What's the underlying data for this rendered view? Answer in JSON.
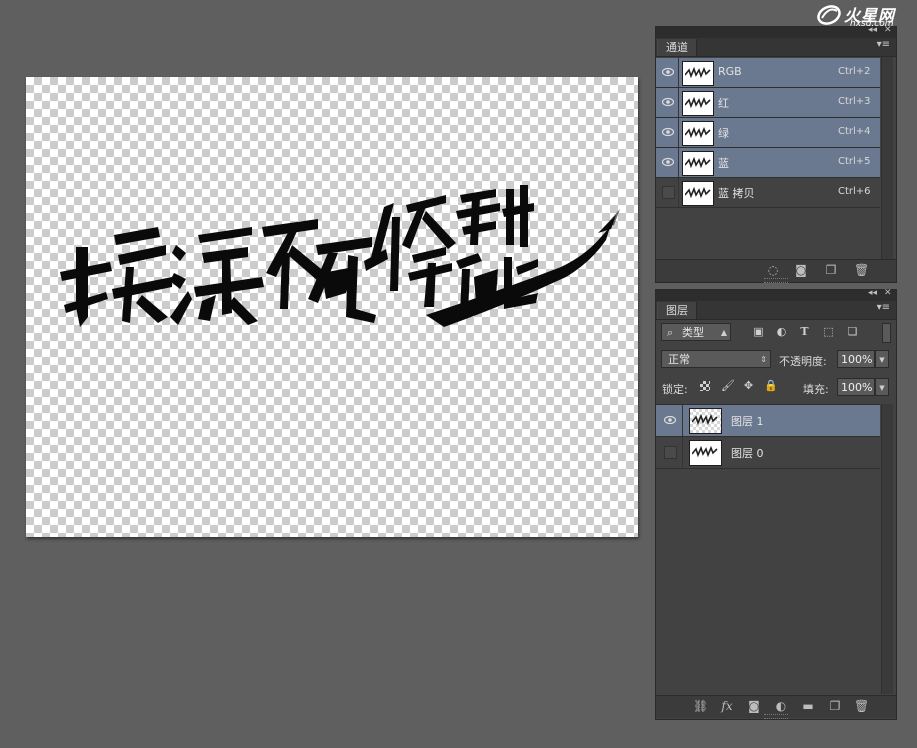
{
  "watermark": {
    "text": "火星网",
    "sub": "hxsd.com"
  },
  "canvas": {
    "artwork_text": "操淡不死修翻能"
  },
  "channels_panel": {
    "tab_label": "通道",
    "collapse_icon": "double-chevron-left",
    "close_icon": "close",
    "menu_icon": "panel-menu",
    "rows": [
      {
        "name": "RGB",
        "shortcut": "Ctrl+2",
        "visible": true,
        "selected": true
      },
      {
        "name": "红",
        "shortcut": "Ctrl+3",
        "visible": true,
        "selected": true
      },
      {
        "name": "绿",
        "shortcut": "Ctrl+4",
        "visible": true,
        "selected": true
      },
      {
        "name": "蓝",
        "shortcut": "Ctrl+5",
        "visible": true,
        "selected": true
      },
      {
        "name": "蓝 拷贝",
        "shortcut": "Ctrl+6",
        "visible": false,
        "selected": false
      }
    ],
    "footer_icons": [
      "load-selection-icon",
      "save-selection-icon",
      "new-channel-icon",
      "delete-icon"
    ]
  },
  "layers_panel": {
    "tab_label": "图层",
    "filter": {
      "label": "类型",
      "icons": [
        "image-filter-icon",
        "adjustment-filter-icon",
        "type-filter-icon",
        "shape-filter-icon",
        "smart-object-filter-icon"
      ]
    },
    "blend_mode": "正常",
    "opacity_label": "不透明度:",
    "opacity_value": "100%",
    "lock_label": "锁定:",
    "lock_icons": [
      "lock-transparent-icon",
      "lock-image-icon",
      "lock-position-icon",
      "lock-all-icon"
    ],
    "fill_label": "填充:",
    "fill_value": "100%",
    "layers": [
      {
        "name": "图层 1",
        "visible": true,
        "selected": true
      },
      {
        "name": "图层 0",
        "visible": false,
        "selected": false
      }
    ],
    "footer_icons": [
      "link-icon",
      "fx-icon",
      "mask-icon",
      "adjustment-icon",
      "group-folder-icon",
      "new-layer-icon",
      "delete-icon"
    ],
    "fx_label": "fx"
  },
  "colors": {
    "workspace": "#5f5f5f",
    "panel": "#424242",
    "selection": "#6a7890"
  }
}
